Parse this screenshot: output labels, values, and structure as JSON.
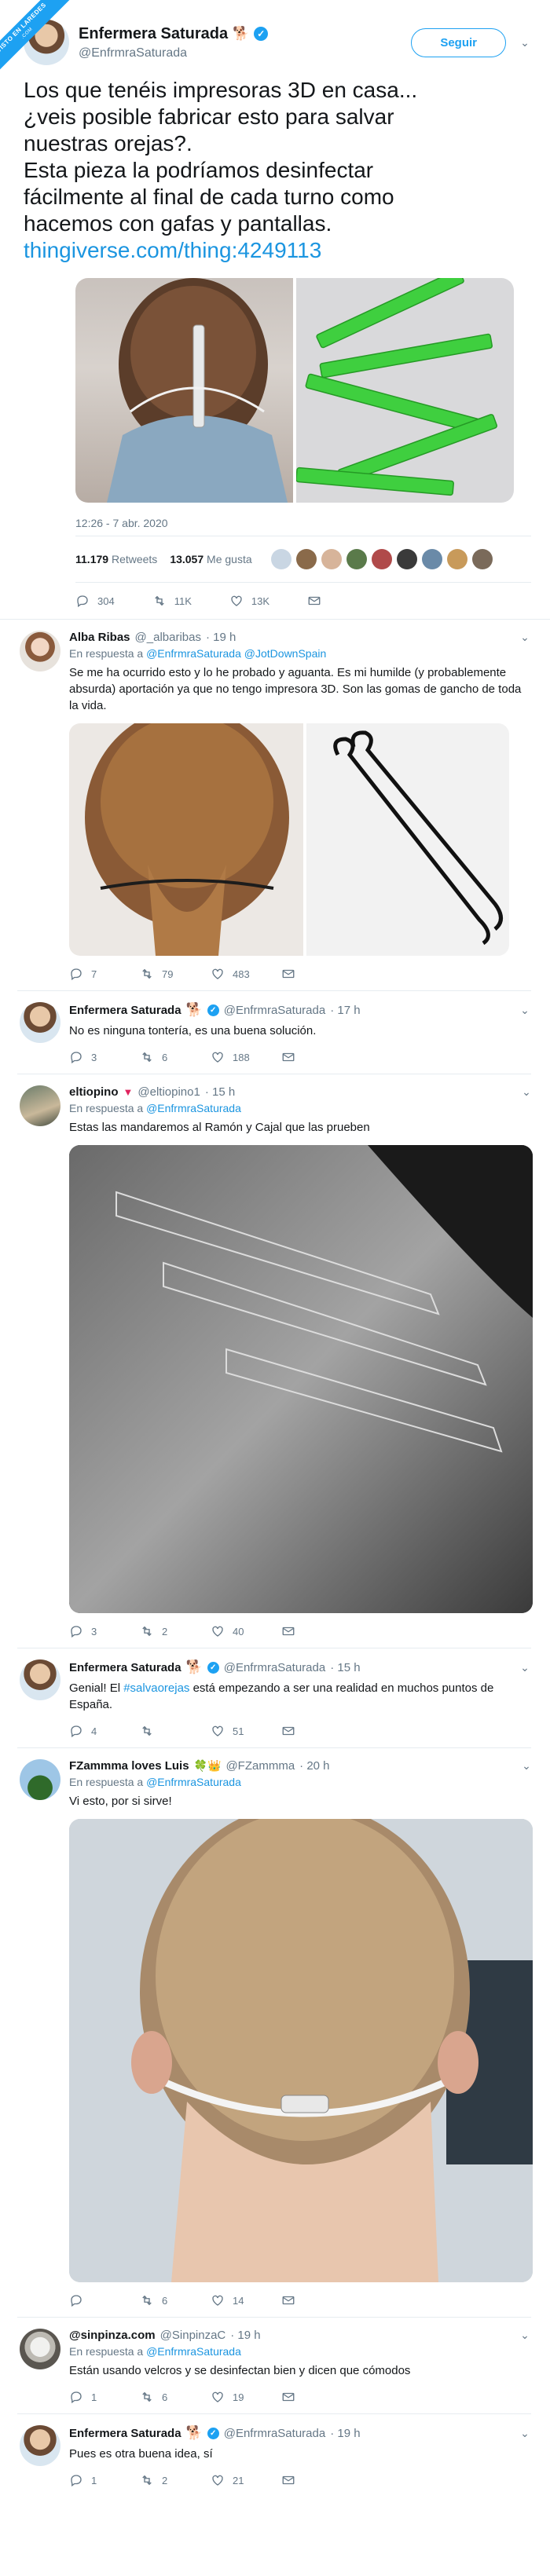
{
  "ribbon": {
    "line1": "VISTO EN LAREDES",
    "line2": ".COM"
  },
  "main": {
    "name": "Enfermera Saturada",
    "handle": "@EnfrmraSaturada",
    "follow_label": "Seguir",
    "text_lines": [
      "Los que tenéis impresoras 3D en casa...",
      "¿veis posible fabricar esto para salvar",
      "nuestras orejas?.",
      "Esta pieza la podríamos desinfectar",
      "fácilmente al final de cada turno como",
      "hacemos con gafas y pantallas."
    ],
    "link": "thingiverse.com/thing:4249113",
    "timestamp": "12:26 - 7 abr. 2020",
    "retweets_count": "11.179",
    "retweets_label": "Retweets",
    "likes_count": "13.057",
    "likes_label": "Me gusta",
    "replies": "304",
    "rts": "11K",
    "likes": "13K"
  },
  "replies": [
    {
      "name": "Alba Ribas",
      "handle": "@_albaribas",
      "time": "· 19 h",
      "replying_prefix": "En respuesta a",
      "replying_to": [
        "@EnfrmraSaturada",
        "@JotDownSpain"
      ],
      "text": "Se me ha ocurrido esto y lo he probado y aguanta. Es mi humilde (y probablemente absurda) aportación ya que no tengo impresora 3D. Son las gomas de gancho de toda la vida.",
      "replies": "7",
      "rts": "79",
      "likes": "483"
    },
    {
      "name": "Enfermera Saturada",
      "handle": "@EnfrmraSaturada",
      "time": "· 17 h",
      "text": "No es ninguna tontería, es una buena solución.",
      "replies": "3",
      "rts": "6",
      "likes": "188"
    },
    {
      "name": "eltiopino",
      "handle": "@eltiopino1",
      "time": "· 15 h",
      "replying_prefix": "En respuesta a",
      "replying_to": [
        "@EnfrmraSaturada"
      ],
      "text": "Estas las mandaremos al Ramón y Cajal que las prueben",
      "replies": "3",
      "rts": "2",
      "likes": "40"
    },
    {
      "name": "Enfermera Saturada",
      "handle": "@EnfrmraSaturada",
      "time": "· 15 h",
      "text_pre": "Genial! El ",
      "hashtag": "#salvaorejas",
      "text_post": " está empezando a ser una realidad en muchos puntos de España.",
      "replies": "4",
      "rts": "",
      "likes": "51"
    },
    {
      "name": "FZammma loves Luis",
      "handle": "@FZammma",
      "time": "· 20 h",
      "replying_prefix": "En respuesta a",
      "replying_to": [
        "@EnfrmraSaturada"
      ],
      "text": "Vi esto, por si sirve!",
      "replies": "",
      "rts": "6",
      "likes": "14"
    },
    {
      "name": "@sinpinza.com",
      "handle": "@SinpinzaC",
      "time": "· 19 h",
      "replying_prefix": "En respuesta a",
      "replying_to": [
        "@EnfrmraSaturada"
      ],
      "text": "Están usando velcros y se desinfectan bien y dicen que cómodos",
      "replies": "1",
      "rts": "6",
      "likes": "19"
    },
    {
      "name": "Enfermera Saturada",
      "handle": "@EnfrmraSaturada",
      "time": "· 19 h",
      "text": "Pues es otra buena idea, sí",
      "replies": "1",
      "rts": "2",
      "likes": "21"
    }
  ],
  "icons": [
    "reply-icon",
    "retweet-icon",
    "like-icon",
    "mail-icon",
    "chevron-down-icon",
    "verified-icon"
  ],
  "colors": {
    "accent": "#1da1f2",
    "link": "#1b95e0",
    "muted": "#657786"
  }
}
